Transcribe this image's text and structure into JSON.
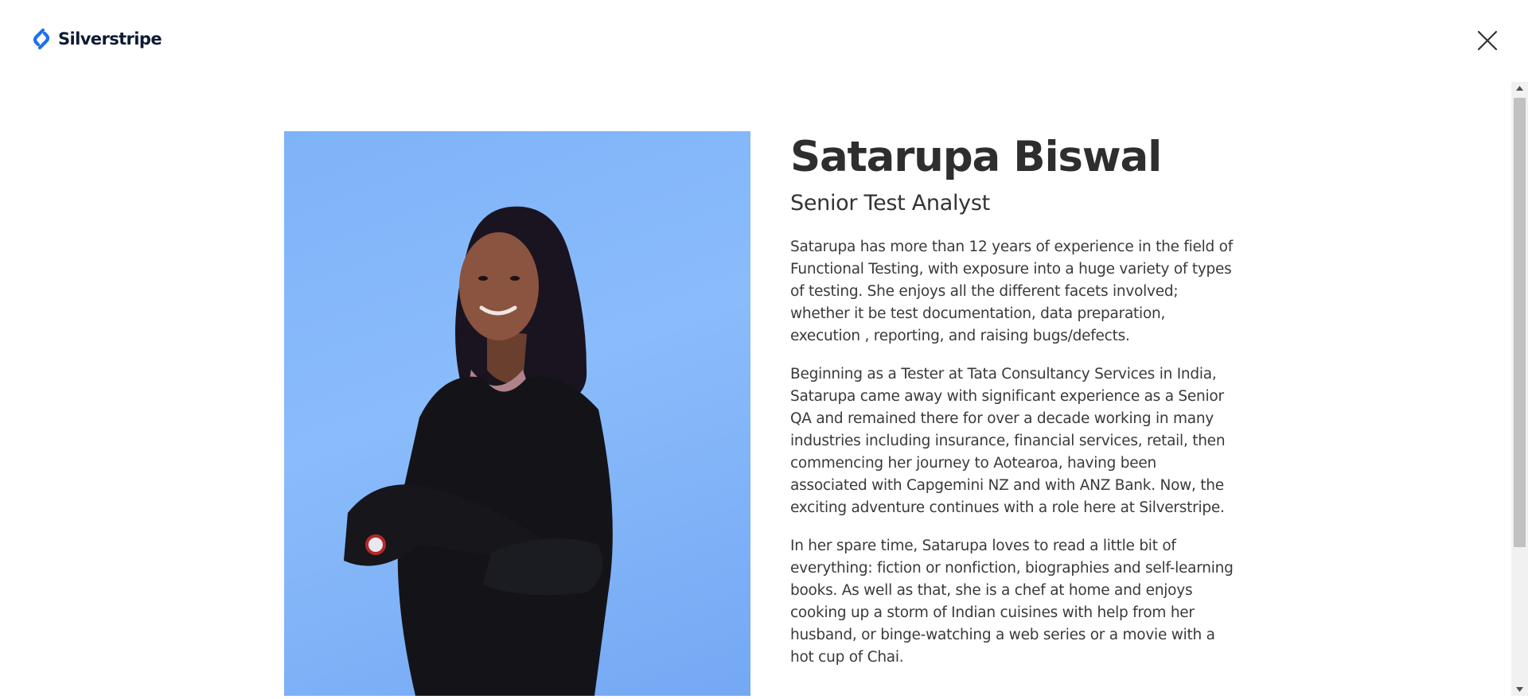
{
  "header": {
    "logo_text": "Silverstripe",
    "close_icon": "close-icon"
  },
  "profile": {
    "name": "Satarupa Biswal",
    "title": "Senior Test Analyst",
    "bio": [
      "Satarupa has more than 12 years of experience in the field of Functional Testing, with exposure into a huge variety of types of testing. She enjoys all the different facets involved; whether it be test documentation, data preparation, execution , reporting, and raising bugs/defects.",
      "Beginning as a Tester at Tata Consultancy Services in India, Satarupa came away with significant experience as a Senior QA and remained there for over a decade working in many industries including insurance, financial services, retail, then commencing her journey to Aotearoa, having been associated with Capgemini NZ and with ANZ Bank. Now, the exciting adventure continues with a role here at Silverstripe.",
      "In her spare time, Satarupa loves to read a little bit of everything: fiction or nonfiction, biographies and self-learning books. As well as that, she is a chef at home and enjoys cooking up a storm of Indian cuisines with help from her husband, or binge-watching a web series or a movie with a hot cup of Chai."
    ],
    "photo_background": "#7eb3f9"
  },
  "colors": {
    "logo_blue": "#1f6ff0",
    "logo_text": "#0d1b33",
    "heading": "#2e2e2e",
    "body_text": "#3a3a3a"
  }
}
